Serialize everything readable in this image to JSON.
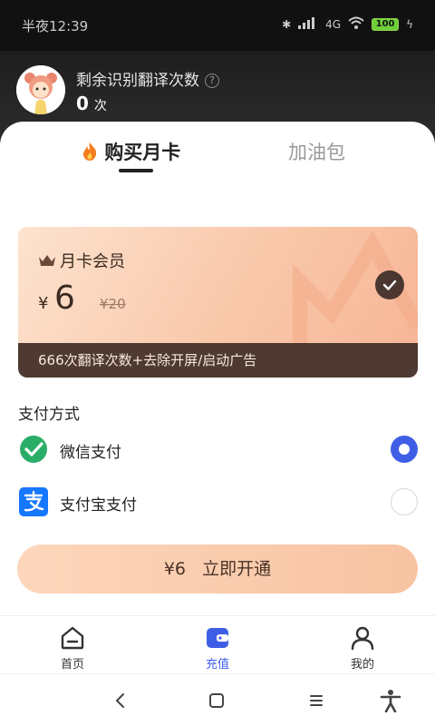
{
  "status_bar": {
    "time": "半夜12:39",
    "network": "4G",
    "battery": "100"
  },
  "header": {
    "title": "剩余识别翻译次数",
    "help": "?",
    "count": "0",
    "count_unit": "次"
  },
  "tabs": [
    {
      "label": "购买月卡",
      "active": true
    },
    {
      "label": "加油包",
      "active": false
    }
  ],
  "card": {
    "title": "月卡会员",
    "currency": "¥",
    "price": "6",
    "original_price": "¥20",
    "benefit": "666次翻译次数+去除开屏/启动广告",
    "selected": true
  },
  "payment": {
    "heading": "支付方式",
    "methods": [
      {
        "label": "微信支付",
        "selected": true
      },
      {
        "label": "支付宝支付",
        "selected": false
      }
    ]
  },
  "cta": {
    "label": "¥6   立即开通"
  },
  "bottom_nav": [
    {
      "label": "首页",
      "active": false
    },
    {
      "label": "充值",
      "active": true
    },
    {
      "label": "我的",
      "active": false
    }
  ],
  "colors": {
    "accent": "#3f5ee6",
    "card_dark": "#4e3a33",
    "card_peach": "#f9c7a9",
    "wechat_green": "#2aae67",
    "alipay_blue": "#1677ff"
  }
}
